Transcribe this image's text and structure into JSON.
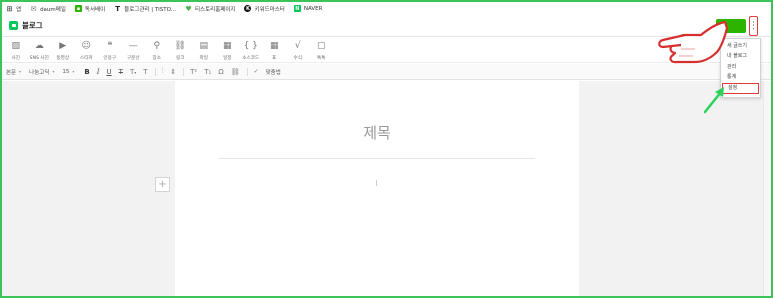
{
  "bookmarks": [
    {
      "label": "앱",
      "icon": "apps-grid-icon",
      "color": "#4a4a4a"
    },
    {
      "label": "daum메일",
      "icon": "mail-icon",
      "color": "#777777"
    },
    {
      "label": "독서배이",
      "icon": "book-site-icon",
      "color": "#2db400"
    },
    {
      "label": "블로그관리 | TISTO...",
      "icon": "tistory-t-icon",
      "color": "#222222"
    },
    {
      "label": "티스토리홈페이지",
      "icon": "heart-icon",
      "color": "#45b649"
    },
    {
      "label": "키워드마스터",
      "icon": "k-badge-icon",
      "color": "#111111"
    },
    {
      "label": "NAVER",
      "icon": "naver-n-icon",
      "color": "#03c75a"
    }
  ],
  "header": {
    "brand": "블로그",
    "more_glyph": "⋮",
    "accent": "#2db400"
  },
  "insert_toolbar": [
    {
      "label": "사진",
      "icon": "photo-icon",
      "glyph": "▨"
    },
    {
      "label": "SNS 사진",
      "icon": "cloud-photo-icon",
      "glyph": "☁"
    },
    {
      "label": "동영상",
      "icon": "video-icon",
      "glyph": "▶"
    },
    {
      "label": "스티커",
      "icon": "sticker-smile-icon",
      "glyph": "☺"
    },
    {
      "label": "인용구",
      "icon": "quote-icon",
      "glyph": "❝"
    },
    {
      "label": "구분선",
      "icon": "divider-line-icon",
      "glyph": "—"
    },
    {
      "label": "장소",
      "icon": "place-pin-icon",
      "glyph": "⚲"
    },
    {
      "label": "링크",
      "icon": "link-icon",
      "glyph": "⛓"
    },
    {
      "label": "파일",
      "icon": "file-icon",
      "glyph": "▤"
    },
    {
      "label": "일정",
      "icon": "calendar-icon",
      "glyph": "▦"
    },
    {
      "label": "소스코드",
      "icon": "source-code-icon",
      "glyph": "{ }"
    },
    {
      "label": "표",
      "icon": "table-grid-icon",
      "glyph": "▦"
    },
    {
      "label": "수식",
      "icon": "formula-icon",
      "glyph": "√"
    },
    {
      "label": "톡톡",
      "icon": "talk-bubble-icon",
      "glyph": "▢"
    }
  ],
  "format_toolbar": {
    "paragraph": "본문",
    "font": "나눔고딕",
    "size": "15",
    "align_label": "맞춤법"
  },
  "editor": {
    "title_placeholder": "제목",
    "add_glyph": "+"
  },
  "dropdown": {
    "items": [
      {
        "label": "새 글쓰기"
      },
      {
        "label": "내 블로그"
      },
      {
        "label": "관리"
      },
      {
        "label": "통계"
      },
      {
        "label": "설정"
      }
    ],
    "highlight_color": "#e23b3b"
  },
  "annotation": {
    "arrow_color": "#2bd15a"
  }
}
